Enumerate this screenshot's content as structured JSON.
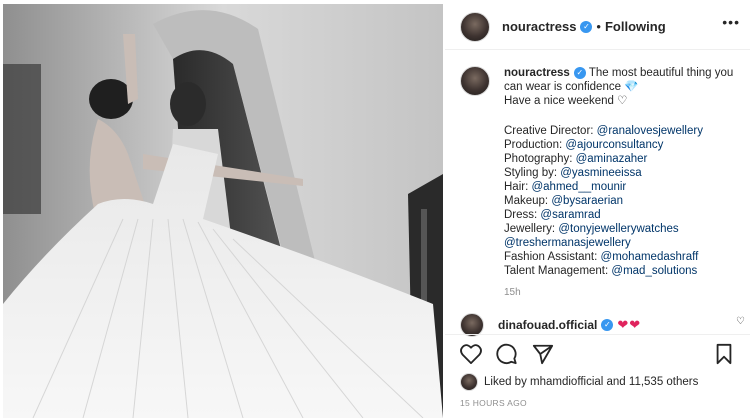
{
  "header": {
    "username": "nouractress",
    "separator": "•",
    "follow_status": "Following",
    "more_icon": "ellipsis-icon"
  },
  "caption": {
    "username": "nouractress",
    "line1": "The most beautiful thing you can wear is confidence",
    "line2": "Have a nice weekend",
    "credits": [
      {
        "label": "Creative Director: ",
        "mention": "@ranalovesjewellery"
      },
      {
        "label": "Production: ",
        "mention": "@ajourconsultancy"
      },
      {
        "label": "Photography: ",
        "mention": "@aminazaher"
      },
      {
        "label": "Styling by: ",
        "mention": "@yasmineeissa"
      },
      {
        "label": "Hair: ",
        "mention": "@ahmed__mounir"
      },
      {
        "label": "Makeup: ",
        "mention": "@bysaraerian"
      },
      {
        "label": "Dress: ",
        "mention": "@saramrad"
      },
      {
        "label": "Jewellery: ",
        "mention": "@tonyjewellerywatches"
      },
      {
        "label": "",
        "mention": "@treshermanasjewellery"
      },
      {
        "label": "Fashion Assistant: ",
        "mention": "@mohamedashraff"
      },
      {
        "label": "Talent Management: ",
        "mention": "@mad_solutions"
      }
    ],
    "time": "15h"
  },
  "comment": {
    "username": "dinafouad.official",
    "hearts": "❤❤"
  },
  "actions": {
    "like_icon": "heart-icon",
    "comment_icon": "comment-icon",
    "share_icon": "share-icon",
    "save_icon": "bookmark-icon"
  },
  "likes": {
    "text": "Liked by mhamdiofficial and 11,535 others"
  },
  "timestamp": "15 HOURS AGO",
  "colors": {
    "verified": "#3897f0",
    "mention": "#003569",
    "heart": "#e0245e"
  }
}
